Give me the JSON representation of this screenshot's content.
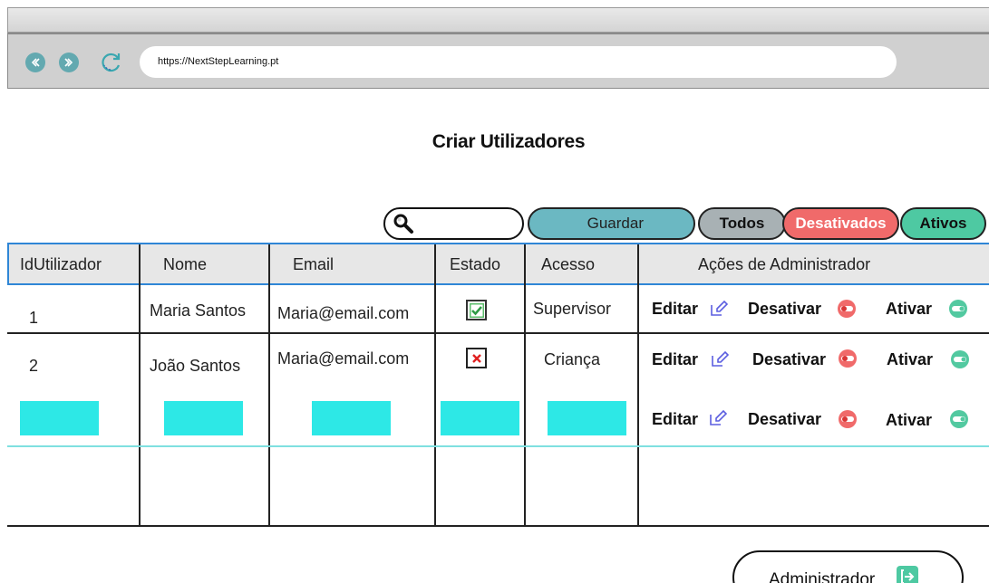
{
  "browser": {
    "url": "https://NextStepLearning.pt",
    "icons": {
      "back": "back-arrow-icon",
      "forward": "forward-arrow-icon",
      "refresh": "refresh-icon"
    },
    "accent": "#63a9b0"
  },
  "page": {
    "title": "Criar Utilizadores"
  },
  "toolbar": {
    "search_icon": "magnifier-icon",
    "search_value": "",
    "save_label": "Guardar",
    "filter_all": "Todos",
    "filter_inactive": "Desativados",
    "filter_active": "Ativos",
    "colors": {
      "save": "#6bb8c2",
      "all": "#a8b1b4",
      "inactive": "#f06a6a",
      "active": "#4ec9a2"
    }
  },
  "table": {
    "columns": [
      "IdUtilizador",
      "Nome",
      "Email",
      "Estado",
      "Acesso",
      "Ações de Administrador"
    ],
    "rows": [
      {
        "id": "1",
        "name": "Maria Santos",
        "email": "Maria@email.com",
        "status": "checked",
        "access": "Supervisor"
      },
      {
        "id": "2",
        "name": "João Santos",
        "email": "Maria@email.com",
        "status": "unchecked",
        "access": "Criança"
      }
    ],
    "new_row_fill": "#2de8e6",
    "actions": {
      "edit": "Editar",
      "deactivate": "Desativar",
      "activate": "Ativar"
    }
  },
  "footer": {
    "admin_label": "Administrador",
    "admin_icon": "exit-icon"
  }
}
